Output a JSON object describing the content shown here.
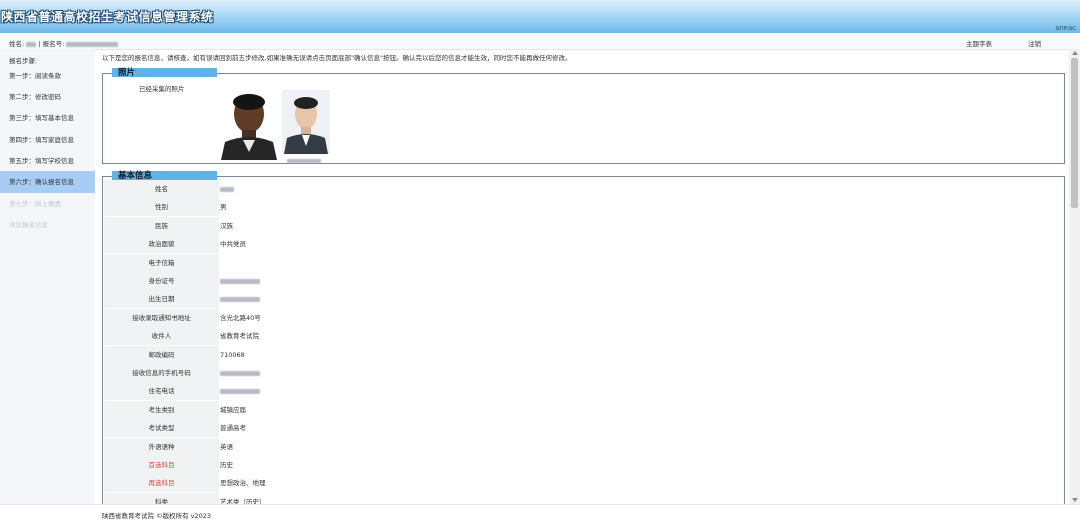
{
  "header": {
    "title": "陕西省普通高校招生考试信息管理系统",
    "brand": "sneac"
  },
  "userbar": {
    "name_label": "姓名:",
    "sep": "| 报名号:",
    "guide": "主题字表",
    "logout": "注销"
  },
  "sidebar": {
    "heading": "报名步骤:",
    "steps": [
      {
        "label": "第一步：阅读条款",
        "state": "normal"
      },
      {
        "label": "第二步：修改密码",
        "state": "normal"
      },
      {
        "label": "第三步：填写基本信息",
        "state": "normal"
      },
      {
        "label": "第四步：填写家庭信息",
        "state": "normal"
      },
      {
        "label": "第五步：填写学校信息",
        "state": "normal"
      },
      {
        "label": "第六步：确认报名信息",
        "state": "active"
      },
      {
        "label": "第七步：网上缴费",
        "state": "disabled"
      },
      {
        "label": "浏览报名信息",
        "state": "disabled"
      }
    ]
  },
  "main": {
    "notice": "以下是您的报名信息，请核查。如有误请回到前五步修改,如果准确无误请点击页面底部\"确认信息\"按钮。确认完以后您的信息才能生效，同时您不能再做任何修改。",
    "photo_section": {
      "legend": "照片",
      "label": "已经采集的照片"
    },
    "basic_section": {
      "legend": "基本信息",
      "rows": [
        {
          "label": "姓名",
          "value": "",
          "blurred": true,
          "red": false
        },
        {
          "label": "性别",
          "value": "男",
          "blurred": false,
          "red": false
        },
        {
          "label": "民族",
          "value": "汉族",
          "blurred": false,
          "red": false
        },
        {
          "label": "政治面貌",
          "value": "中共党员",
          "blurred": false,
          "red": false
        },
        {
          "label": "电子信箱",
          "value": "",
          "blurred": false,
          "red": false
        },
        {
          "label": "身份证号",
          "value": "",
          "blurred": true,
          "red": false
        },
        {
          "label": "出生日期",
          "value": "",
          "blurred": true,
          "red": false
        },
        {
          "label": "接收录取通知书地址",
          "value": "含光北路40号",
          "blurred": false,
          "red": false
        },
        {
          "label": "收件人",
          "value": "省教育考试院",
          "blurred": false,
          "red": false
        },
        {
          "label": "邮政编码",
          "value": "710068",
          "blurred": false,
          "red": false
        },
        {
          "label": "接收信息的手机号码",
          "value": "",
          "blurred": true,
          "red": false
        },
        {
          "label": "住宅电话",
          "value": "",
          "blurred": true,
          "red": false
        },
        {
          "label": "考生类别",
          "value": "城镇应届",
          "blurred": false,
          "red": false
        },
        {
          "label": "考试类型",
          "value": "普通高考",
          "blurred": false,
          "red": false
        },
        {
          "label": "外语语种",
          "value": "英语",
          "blurred": false,
          "red": false
        },
        {
          "label": "首选科目",
          "value": "历史",
          "blurred": false,
          "red": true
        },
        {
          "label": "再选科目",
          "value": "思想政治、地理",
          "blurred": false,
          "red": true
        },
        {
          "label": "科类",
          "value": "艺术类（历史）",
          "blurred": false,
          "red": false
        }
      ]
    }
  },
  "footer": {
    "text": "陕西省教育考试院 ©版权所有 v2023"
  },
  "colors": {
    "header_bottom": "#6fb8e8",
    "active_step": "#a8cdf4",
    "legend": "#5fb3e6",
    "required_label": "#e5463c"
  }
}
